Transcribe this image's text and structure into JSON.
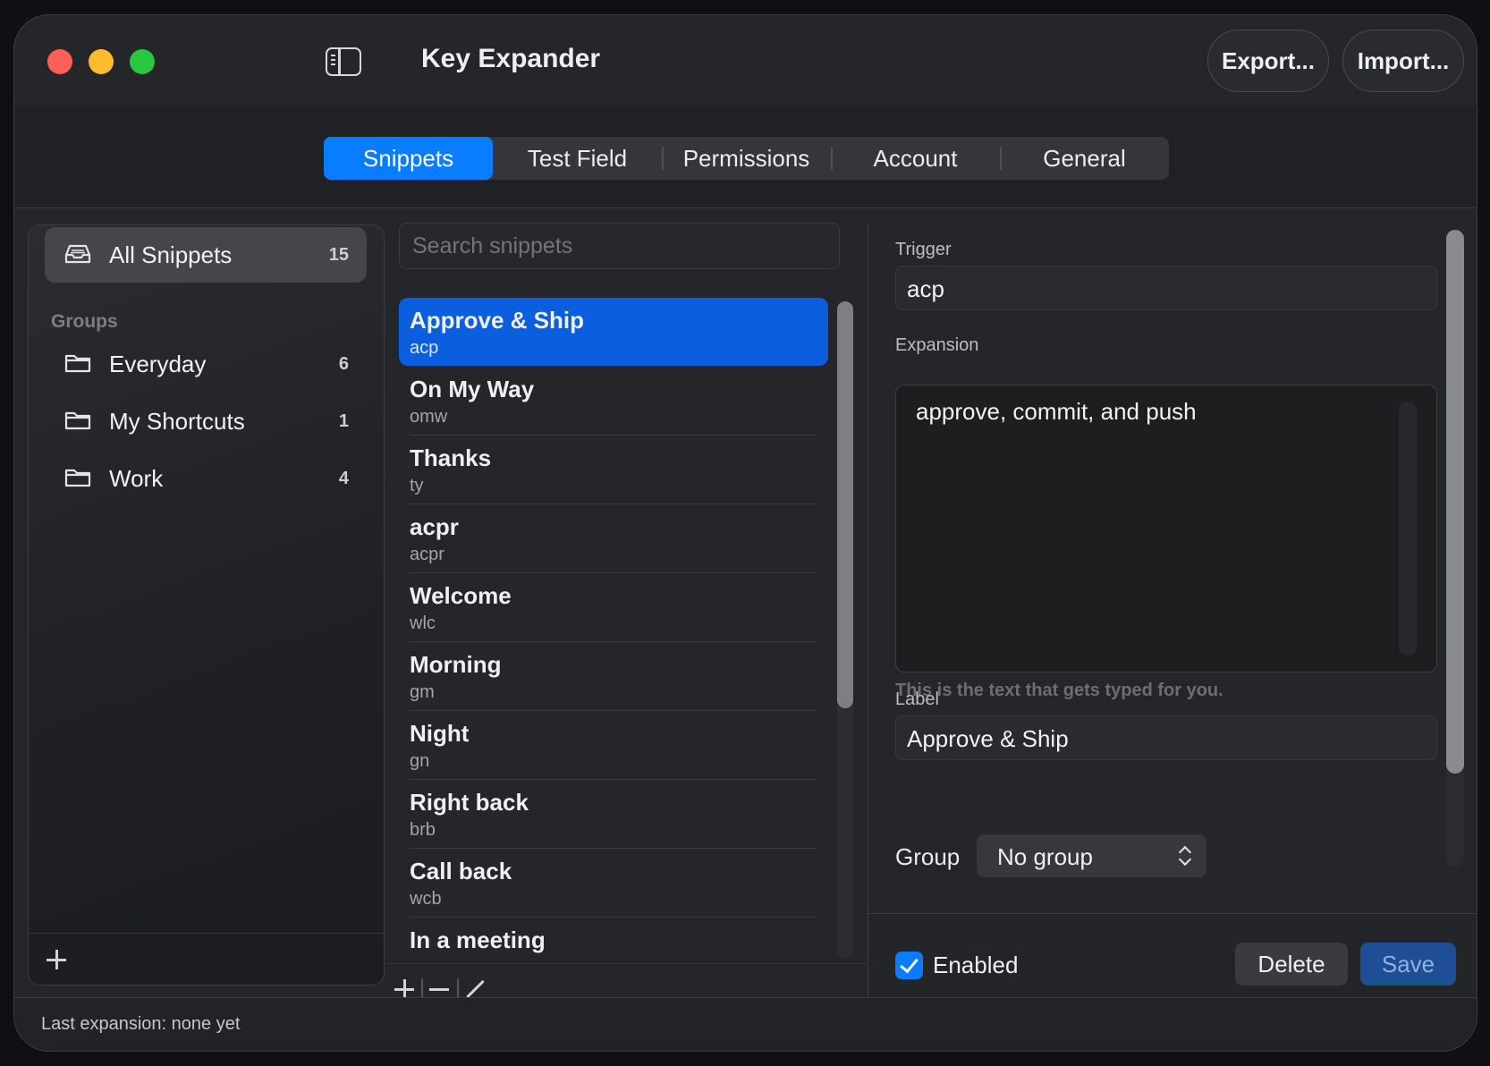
{
  "window": {
    "title": "Key Expander",
    "export_label": "Export...",
    "import_label": "Import..."
  },
  "tabs": [
    {
      "label": "Snippets",
      "active": true
    },
    {
      "label": "Test Field",
      "active": false
    },
    {
      "label": "Permissions",
      "active": false
    },
    {
      "label": "Account",
      "active": false
    },
    {
      "label": "General",
      "active": false
    }
  ],
  "sidebar": {
    "all_snippets": {
      "label": "All Snippets",
      "count": "15",
      "icon": "tray-icon"
    },
    "groups_heading": "Groups",
    "groups": [
      {
        "label": "Everyday",
        "count": "6",
        "icon": "folder-icon"
      },
      {
        "label": "My Shortcuts",
        "count": "1",
        "icon": "folder-icon"
      },
      {
        "label": "Work",
        "count": "4",
        "icon": "folder-icon"
      }
    ]
  },
  "search": {
    "placeholder": "Search snippets"
  },
  "snippets": [
    {
      "name": "Approve & Ship",
      "trigger": "acp",
      "selected": true
    },
    {
      "name": "On My Way",
      "trigger": "omw"
    },
    {
      "name": "Thanks",
      "trigger": "ty"
    },
    {
      "name": "acpr",
      "trigger": "acpr"
    },
    {
      "name": "Welcome",
      "trigger": "wlc"
    },
    {
      "name": "Morning",
      "trigger": "gm"
    },
    {
      "name": "Night",
      "trigger": "gn"
    },
    {
      "name": "Right back",
      "trigger": "brb"
    },
    {
      "name": "Call back",
      "trigger": "wcb"
    },
    {
      "name": "In a meeting",
      "trigger": ""
    }
  ],
  "detail": {
    "trigger_label": "Trigger",
    "trigger_value": "acp",
    "expansion_label": "Expansion",
    "expansion_value": "approve, commit, and push",
    "expansion_hint": "This is the text that gets typed for you.",
    "label_label": "Label",
    "label_value": "Approve & Ship",
    "group_label": "Group",
    "group_value": "No group",
    "enabled_label": "Enabled",
    "enabled": true,
    "delete_label": "Delete",
    "save_label": "Save"
  },
  "status": {
    "text": "Last expansion: none yet"
  },
  "colors": {
    "accent": "#0a7cff",
    "selection": "#0b5ede",
    "save": "#1e4f96"
  }
}
